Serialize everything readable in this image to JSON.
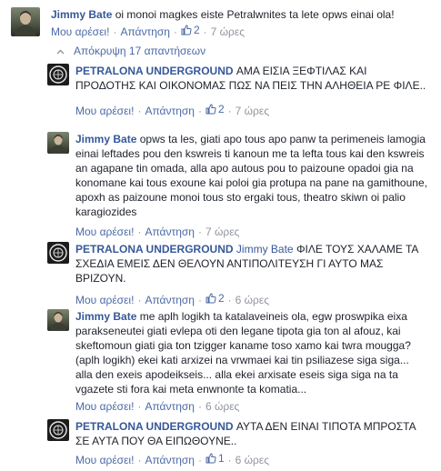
{
  "actions": {
    "like": "Μου αρέσει!",
    "reply": "Απάντηση"
  },
  "comments": [
    {
      "author": "Jimmy Bate",
      "text": "oi monoi magkes eiste Petralwnites ta lete opws einai ola!",
      "likes": "2",
      "time": "7 ώρες"
    },
    {
      "author": "PETRALONA UNDERGROUND",
      "text": "ΑΜΑ ΕΙΣΙΑ ΞΕΦΤΙΛΑΣ ΚΑΙ ΠΡΟΔΟΤΗΣ ΚΑΙ ΟΙΚΟΝΟΜΑΣ ΠΩΣ ΝΑ ΠΕΙΣ ΤΗΝ ΑΛΗΘΕΙΑ ΡΕ ΦΙΛΕ..",
      "likes": "2",
      "time": "7 ώρες"
    },
    {
      "author": "Jimmy Bate",
      "text": "opws ta les, giati apo tous apo panw ta perimeneis lamogia einai leftades pou den kswreis ti kanoun me ta lefta tous kai den kswreis an agapane tin omada, alla apo autous pou to paizoune opadoi gia na konomane kai tous exoune kai poloi gia protupa na pane na gamithoune, apoxh as paizoune monoi tous sto ergaki tous, theatro skiwn oi palio karagiozides",
      "time": "7 ώρες"
    },
    {
      "author": "PETRALONA UNDERGROUND",
      "mention": "Jimmy Bate",
      "text": "ΦΙΛΕ ΤΟΥΣ ΧΑΛΑΜΕ ΤΑ ΣΧΕΔΙΑ ΕΜΕΙΣ ΔΕΝ ΘΕΛΟΥΝ ΑΝΤΙΠΟΛΙΤΕΥΣΗ ΓΙ ΑΥΤΟ ΜΑΣ ΒΡΙΖΟΥΝ.",
      "likes": "2",
      "time": "6 ώρες"
    },
    {
      "author": "Jimmy Bate",
      "text": "me aplh logikh ta katalaveineis ola, egw proswpika eixa parakseneutei giati evlepa oti den legane tipota gia ton al afouz, kai skeftomoun giati gia ton tzigger kaname toso xamo kai twra mougga? (aplh logikh) ekei kati arxizei na vrwmaei kai tin psiliazese siga siga... alla den exeis apodeikseis... alla ekei arxisate eseis siga siga na ta vgazete sti fora kai meta enwnonte ta komatia...",
      "time": "6 ώρες"
    },
    {
      "author": "PETRALONA UNDERGROUND",
      "text": "ΑΥΤΑ ΔΕΝ ΕΙΝΑΙ ΤΙΠΟΤΑ ΜΠΡΟΣΤΑ ΣΕ ΑΥΤΑ ΠΟΥ ΘΑ ΕΙΠΩΘΟΥΝΕ..",
      "likes": "1",
      "time": "6 ώρες"
    }
  ],
  "hide_replies": "Απόκρυψη 17 απαντήσεων",
  "colors": {
    "link": "#365899",
    "meta": "#90949c",
    "text": "#1d2129"
  }
}
